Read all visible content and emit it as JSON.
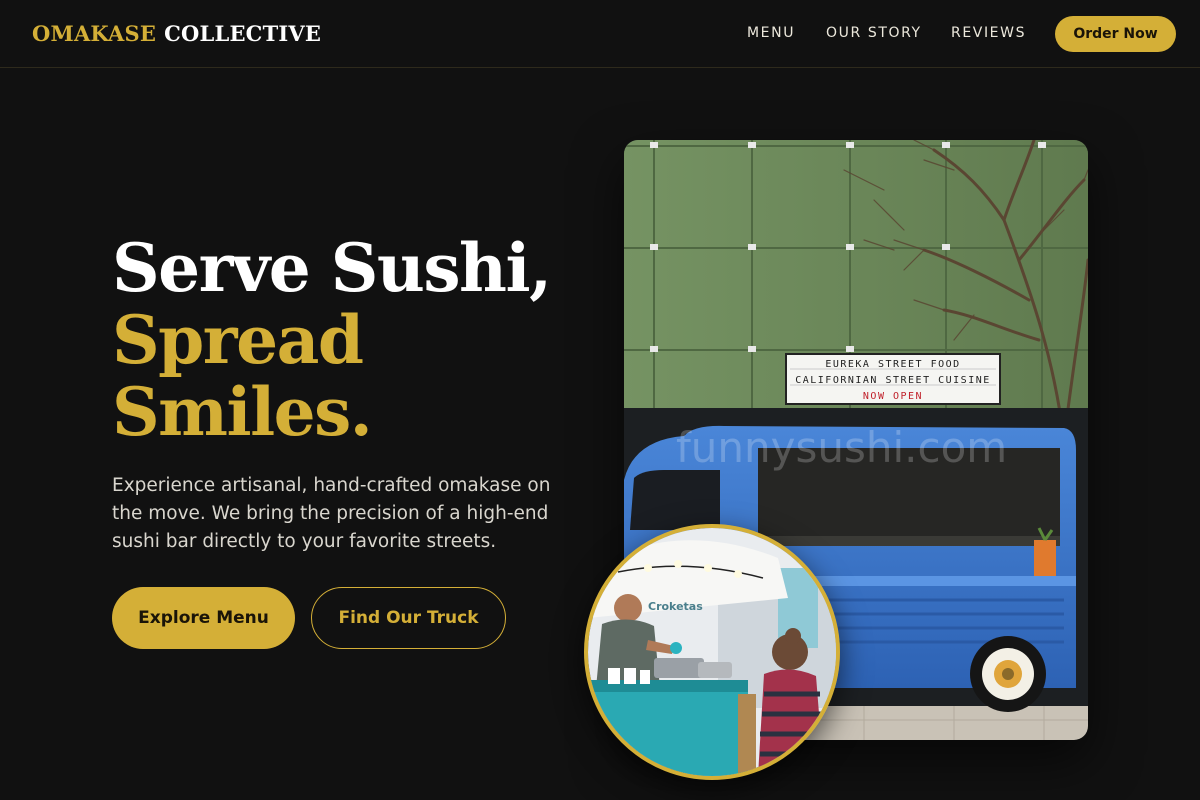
{
  "brand": {
    "part1": "OMAKASE",
    "part2": "COLLECTIVE"
  },
  "nav": {
    "links": [
      {
        "label": "MENU"
      },
      {
        "label": "OUR STORY"
      },
      {
        "label": "REVIEWS"
      }
    ],
    "cta": "Order Now"
  },
  "hero": {
    "headline_line1": "Serve Sushi,",
    "headline_line2": "Spread",
    "headline_line3": "Smiles.",
    "description": "Experience artisanal, hand-crafted omakase on the move. We bring the precision of a high-end sushi bar directly to your favorite streets.",
    "primary_button": "Explore Menu",
    "secondary_button": "Find Our Truck"
  },
  "images": {
    "main": {
      "sign_line1": "EUREKA STREET FOOD",
      "sign_line2": "CALIFORNIAN STREET CUISINE",
      "sign_line3": "NOW OPEN",
      "watermark": "funnysushi.com"
    },
    "inset": {
      "stall_sign": "Croketas"
    }
  },
  "colors": {
    "accent": "#d4af37",
    "background": "#111111",
    "text": "#ffffff"
  }
}
